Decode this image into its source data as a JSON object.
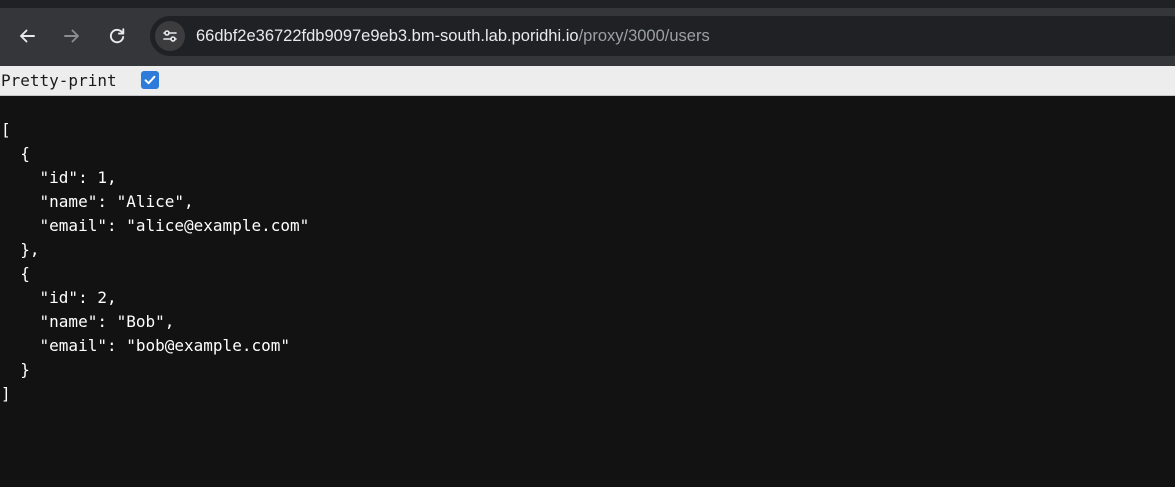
{
  "browser": {
    "url_host": "66dbf2e36722fdb9097e9eb3.bm-south.lab.poridhi.io",
    "url_path": "/proxy/3000/users",
    "icons": [
      "back-arrow-icon",
      "forward-arrow-icon",
      "reload-icon",
      "site-info-tune-icon"
    ]
  },
  "viewer": {
    "pretty_print_label": "Pretty-print",
    "pretty_print_checked": true,
    "checkbox_color": "#2f7bd9"
  },
  "content": {
    "lines": [
      "[",
      "  {",
      "    \"id\": 1,",
      "    \"name\": \"Alice\",",
      "    \"email\": \"alice@example.com\"",
      "  },",
      "  {",
      "    \"id\": 2,",
      "    \"name\": \"Bob\",",
      "    \"email\": \"bob@example.com\"",
      "  }",
      "]"
    ]
  }
}
